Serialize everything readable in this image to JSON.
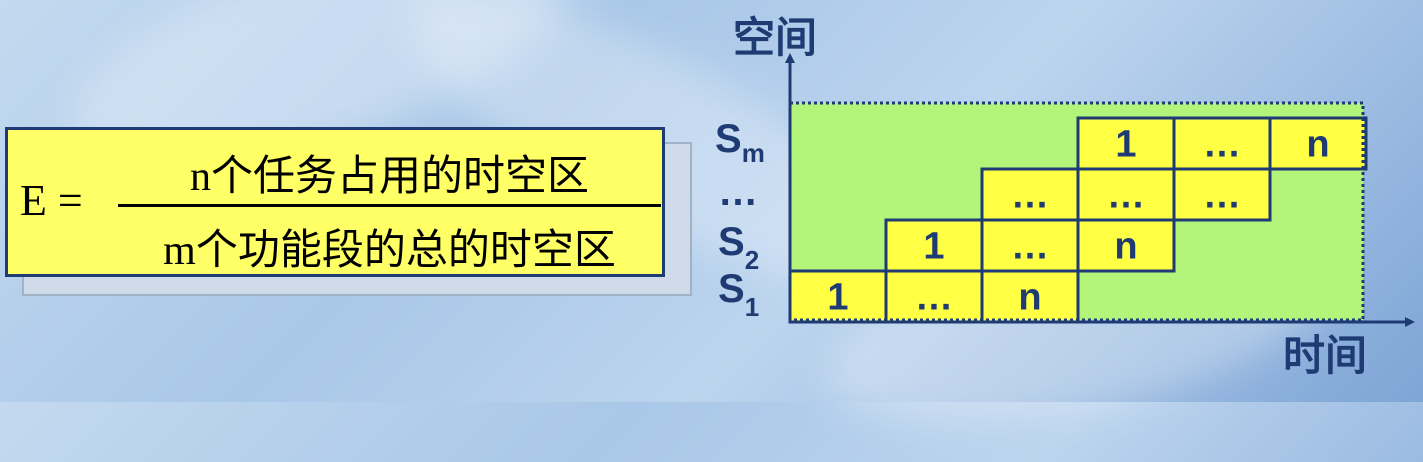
{
  "formula": {
    "lhs": "E =",
    "numerator": "n个任务占用的时空区",
    "denominator": "m个功能段的总的时空区"
  },
  "diagram": {
    "y_axis_label": "空间",
    "x_axis_label": "时间",
    "stage_labels": {
      "top": "S",
      "top_sub": "m",
      "mid": "…",
      "s2": "S",
      "s2_sub": "2",
      "s1": "S",
      "s1_sub": "1"
    },
    "rows": [
      {
        "stage": "S1",
        "cells": [
          "1",
          "…",
          "n"
        ]
      },
      {
        "stage": "S2",
        "cells": [
          "1",
          "…",
          "n"
        ]
      },
      {
        "stage": "…",
        "cells": [
          "…",
          "…",
          "…"
        ]
      },
      {
        "stage": "Sm",
        "cells": [
          "1",
          "…",
          "n"
        ]
      }
    ],
    "colors": {
      "cell_fill": "#ffff44",
      "area_fill": "#b2f57a",
      "outline": "#1f3b73"
    }
  }
}
